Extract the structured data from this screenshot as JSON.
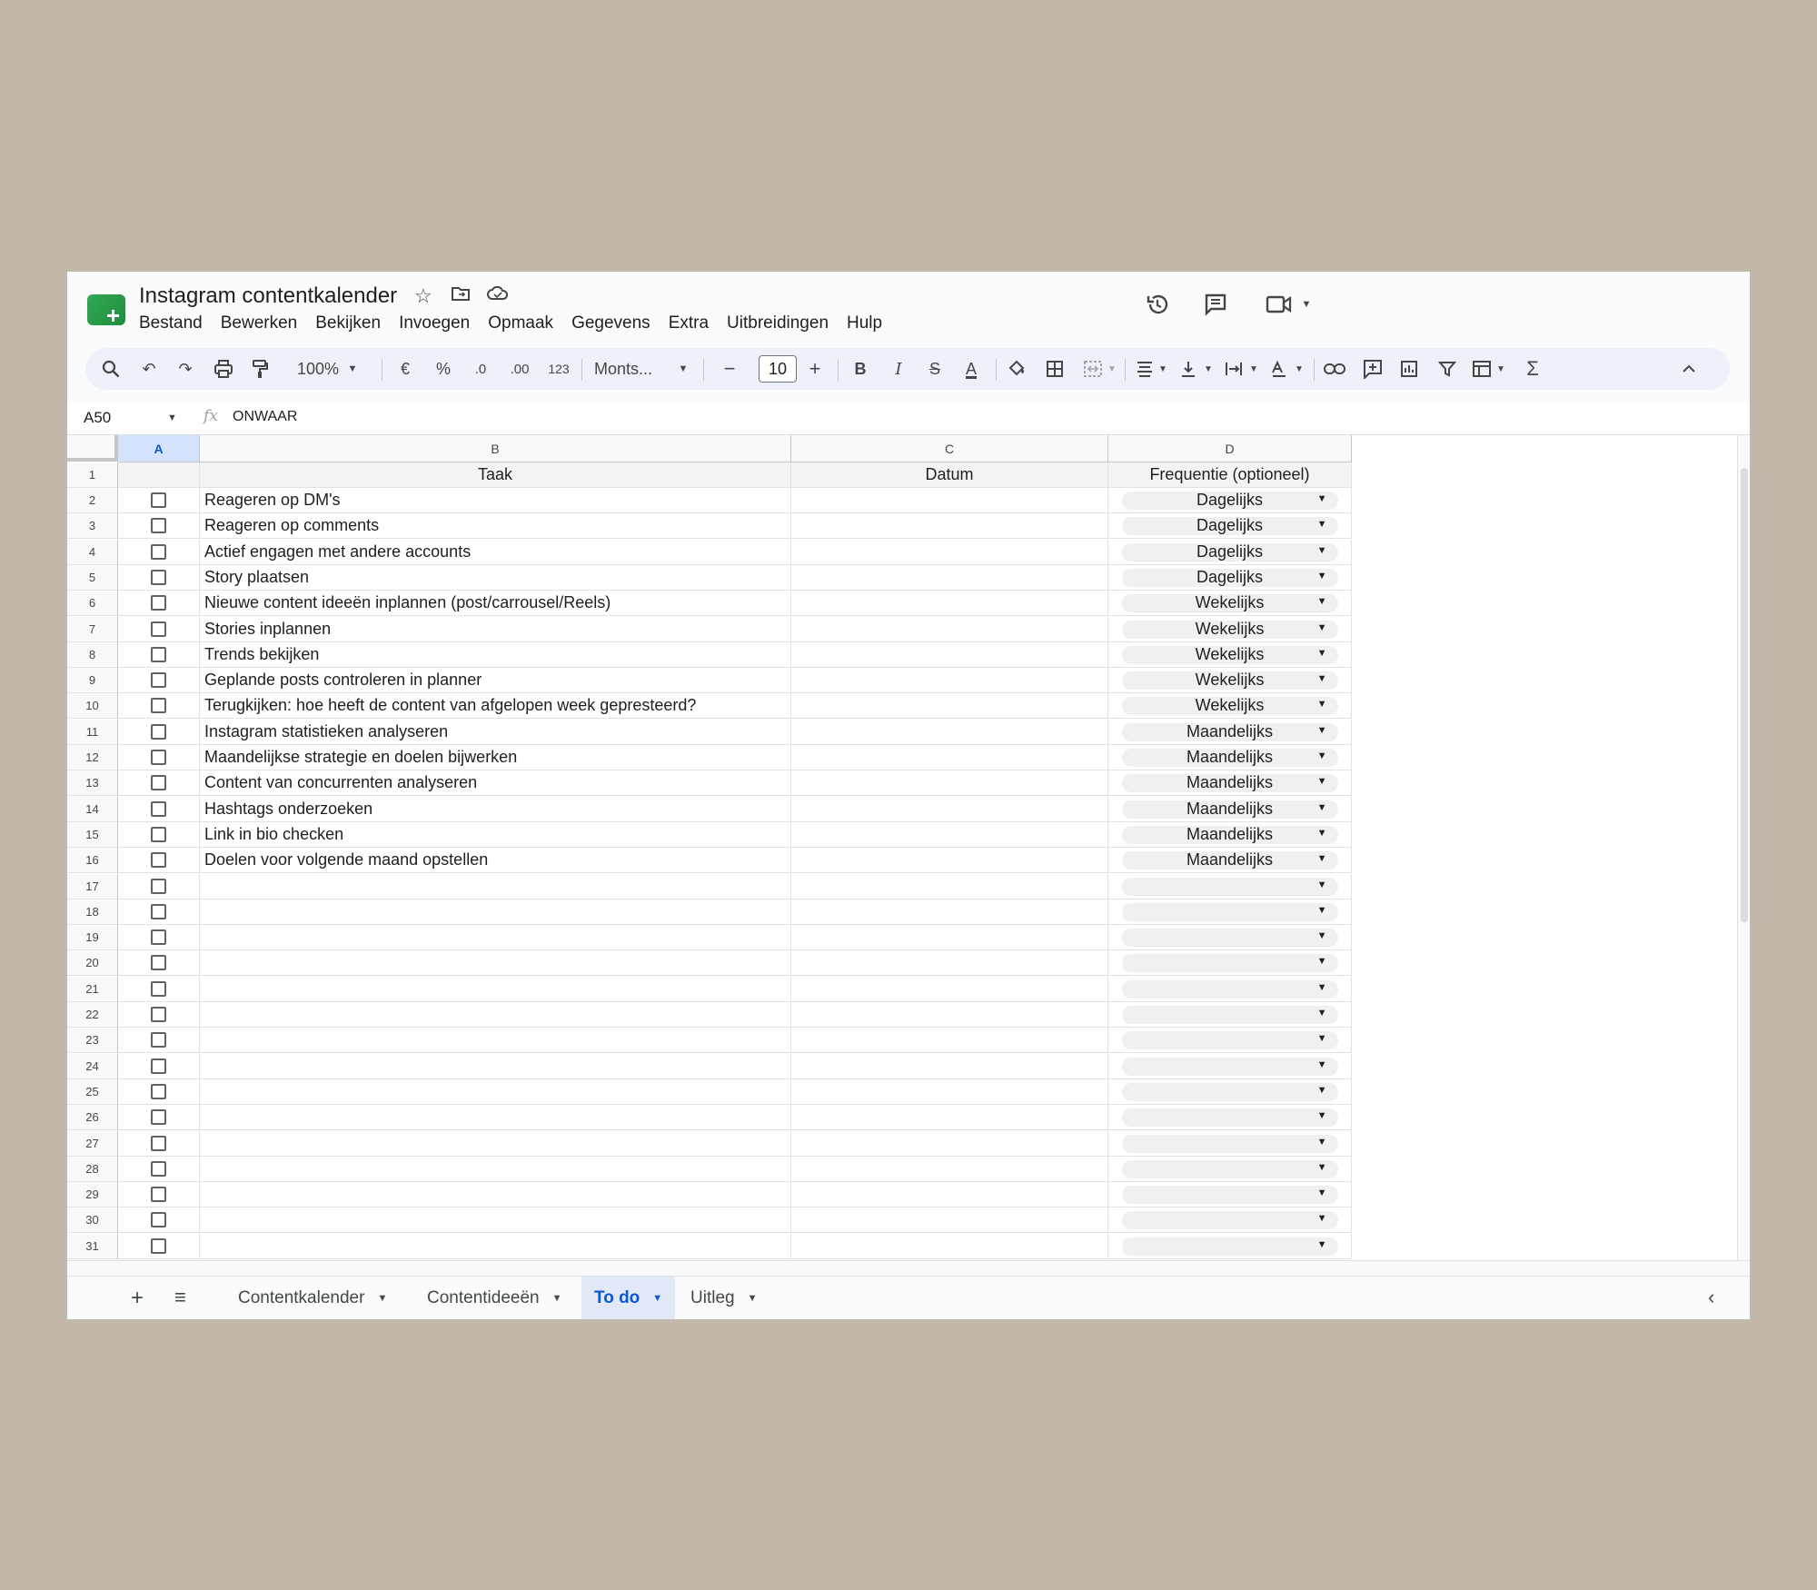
{
  "app": {
    "title": "Instagram contentkalender",
    "menu": [
      "Bestand",
      "Bewerken",
      "Bekijken",
      "Invoegen",
      "Opmaak",
      "Gegevens",
      "Extra",
      "Uitbreidingen",
      "Hulp"
    ]
  },
  "toolbar": {
    "zoom": "100%",
    "currency": "€",
    "percent": "%",
    "dec_minus": ".0",
    "dec_plus": ".00",
    "number_format": "123",
    "font": "Monts...",
    "font_size": "10"
  },
  "formula_bar": {
    "cell_ref": "A50",
    "fx": "fx",
    "value": "ONWAAR"
  },
  "columns": [
    "A",
    "B",
    "C",
    "D"
  ],
  "header_row": {
    "b": "Taak",
    "c": "Datum",
    "d": "Frequentie (optioneel)"
  },
  "rows": [
    {
      "n": "2",
      "task": "Reageren op DM's",
      "freq": "Dagelijks"
    },
    {
      "n": "3",
      "task": "Reageren op comments",
      "freq": "Dagelijks"
    },
    {
      "n": "4",
      "task": "Actief engagen met andere accounts",
      "freq": "Dagelijks"
    },
    {
      "n": "5",
      "task": "Story plaatsen",
      "freq": "Dagelijks"
    },
    {
      "n": "6",
      "task": "Nieuwe content ideeën inplannen (post/carrousel/Reels)",
      "freq": "Wekelijks"
    },
    {
      "n": "7",
      "task": "Stories inplannen",
      "freq": "Wekelijks"
    },
    {
      "n": "8",
      "task": "Trends bekijken",
      "freq": "Wekelijks"
    },
    {
      "n": "9",
      "task": "Geplande posts controleren in planner",
      "freq": "Wekelijks"
    },
    {
      "n": "10",
      "task": "Terugkijken: hoe heeft de content van afgelopen week gepresteerd?",
      "freq": "Wekelijks"
    },
    {
      "n": "11",
      "task": "Instagram statistieken analyseren",
      "freq": "Maandelijks"
    },
    {
      "n": "12",
      "task": "Maandelijkse strategie en doelen bijwerken",
      "freq": "Maandelijks"
    },
    {
      "n": "13",
      "task": "Content van concurrenten analyseren",
      "freq": "Maandelijks"
    },
    {
      "n": "14",
      "task": "Hashtags onderzoeken",
      "freq": "Maandelijks"
    },
    {
      "n": "15",
      "task": "Link in bio checken",
      "freq": "Maandelijks"
    },
    {
      "n": "16",
      "task": "Doelen voor volgende maand opstellen",
      "freq": "Maandelijks"
    },
    {
      "n": "17",
      "task": "",
      "freq": ""
    },
    {
      "n": "18",
      "task": "",
      "freq": ""
    },
    {
      "n": "19",
      "task": "",
      "freq": ""
    },
    {
      "n": "20",
      "task": "",
      "freq": ""
    },
    {
      "n": "21",
      "task": "",
      "freq": ""
    },
    {
      "n": "22",
      "task": "",
      "freq": ""
    },
    {
      "n": "23",
      "task": "",
      "freq": ""
    },
    {
      "n": "24",
      "task": "",
      "freq": ""
    },
    {
      "n": "25",
      "task": "",
      "freq": ""
    },
    {
      "n": "26",
      "task": "",
      "freq": ""
    },
    {
      "n": "27",
      "task": "",
      "freq": ""
    },
    {
      "n": "28",
      "task": "",
      "freq": ""
    },
    {
      "n": "29",
      "task": "",
      "freq": ""
    },
    {
      "n": "30",
      "task": "",
      "freq": ""
    },
    {
      "n": "31",
      "task": "",
      "freq": ""
    }
  ],
  "sheets": [
    {
      "label": "Contentkalender",
      "active": false
    },
    {
      "label": "Contentideeën",
      "active": false
    },
    {
      "label": "To do",
      "active": true
    },
    {
      "label": "Uitleg",
      "active": false
    }
  ],
  "colors": {
    "accent": "#0b57d0",
    "selected_header": "#d3e3fd",
    "background": "#c2b8ab"
  }
}
